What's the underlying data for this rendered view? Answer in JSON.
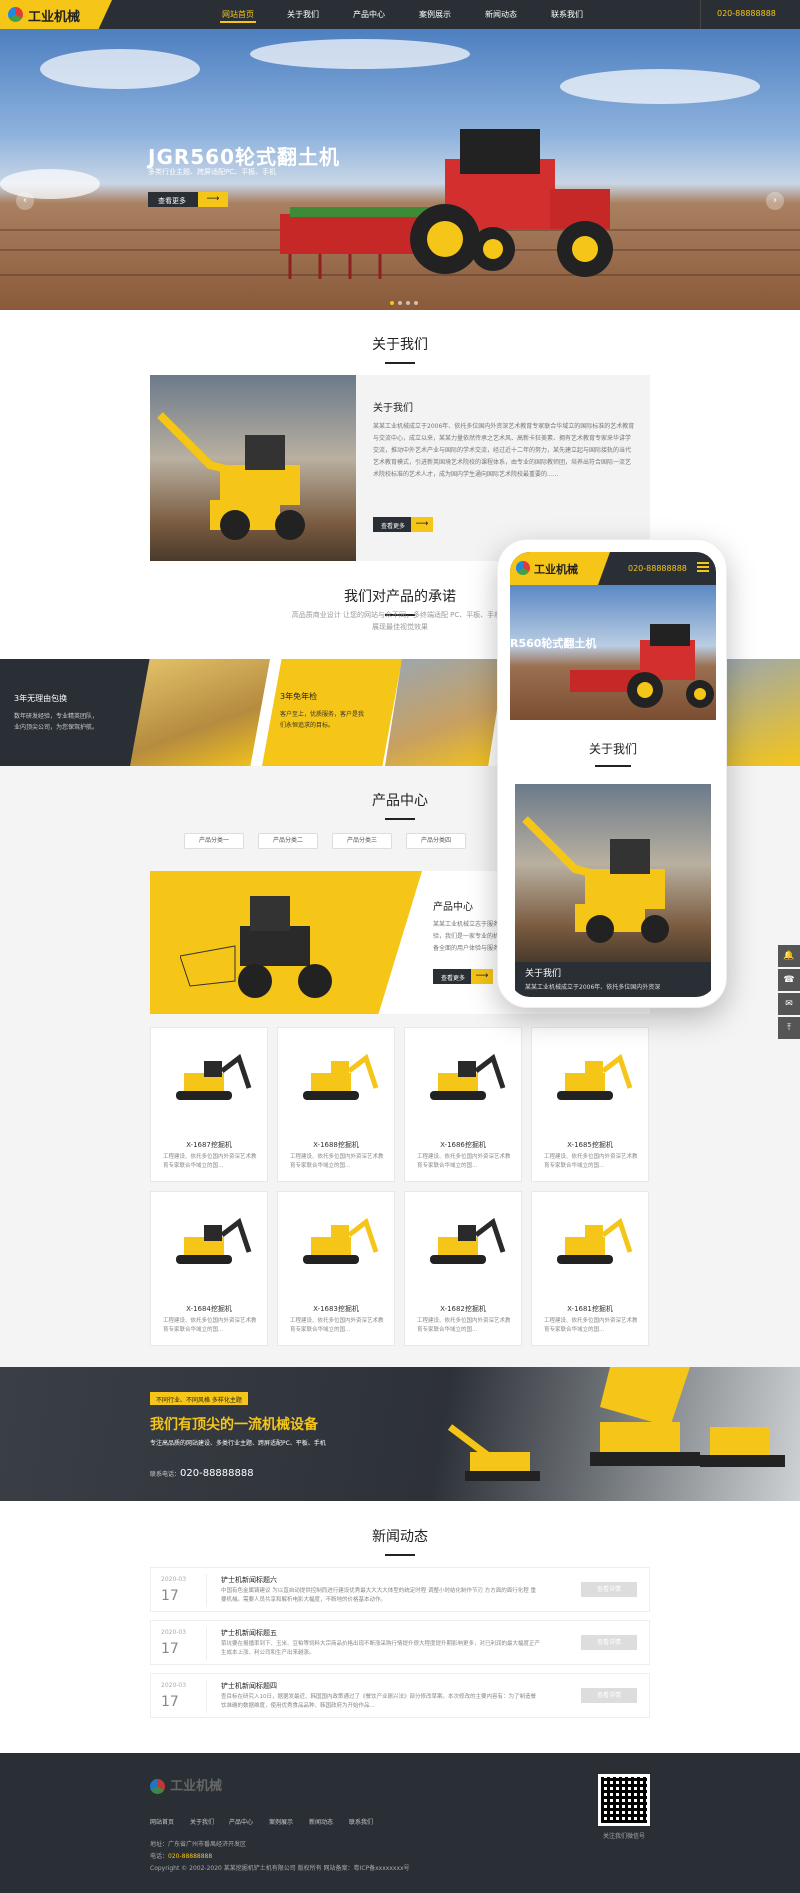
{
  "nav": {
    "logo": "工业机械",
    "items": [
      "网站首页",
      "关于我们",
      "产品中心",
      "案例展示",
      "新闻动态",
      "联系我们"
    ],
    "tel": "020-88888888"
  },
  "hero": {
    "title": "JGR560轮式翻土机",
    "subtitle": "多类行业主题、跨屏适配PC、平板、手机",
    "more": "查看更多"
  },
  "about": {
    "section_title": "关于我们",
    "heading": "关于我们",
    "text": "某某工业机械成立于2006年、依托多位国内外资深艺术教育专家联合华域立的国际标准的艺术教育与交流中心，成立以来，某某力量依然传承之艺术风、高新卡狂美素、拥有艺术教育专家来华讲学交流，推动中外艺术产业与国际的学术交流，经过近十二年的努力，某先建立起与国际接轨的当代艺术教育模式，引进新英国境艺术院校的课程体系，由专业的国际教师团，培养出符合国际一流艺术院校标准的艺术人才，成为国内学生通向国际艺术院校最重要的......",
    "more": "查看更多"
  },
  "promise": {
    "section_title": "我们对产品的承诺",
    "desc_line1": "高品质商业设计 让您的网站与众不同，多终端适配 PC、平板、手机等",
    "desc_line2": "展现最佳视觉效果",
    "items": [
      {
        "title": "3年无理由包换",
        "text_line1": "数年研发经验，专业精英团队，",
        "text_line2": "业内顶尖公司，为您保驾护航。"
      },
      {
        "title": "3年免年检",
        "text_line1": "客户至上，优质服务，客户是我",
        "text_line2": "们永恒追求的目标。"
      }
    ]
  },
  "products": {
    "section_title": "产品中心",
    "tabs": [
      "产品分类一",
      "产品分类二",
      "产品分类三",
      "产品分类四"
    ],
    "feature": {
      "title": "产品中心",
      "text": "某某工业机械立志于服务体验，我们是一家专业的机械设备全面的用户体验与服务",
      "more": "查看更多"
    },
    "items": [
      {
        "name": "X-1687挖掘机",
        "desc": "工程建设、依托多位国内外资深艺术教育专家联合华域立的国..."
      },
      {
        "name": "X-1688挖掘机",
        "desc": "工程建设、依托多位国内外资深艺术教育专家联合华域立的国..."
      },
      {
        "name": "X-1686挖掘机",
        "desc": "工程建设、依托多位国内外资深艺术教育专家联合华域立的国..."
      },
      {
        "name": "X-1685挖掘机",
        "desc": "工程建设、依托多位国内外资深艺术教育专家联合华域立的国..."
      },
      {
        "name": "X-1684挖掘机",
        "desc": "工程建设、依托多位国内外资深艺术教育专家联合华域立的国..."
      },
      {
        "name": "X-1683挖掘机",
        "desc": "工程建设、依托多位国内外资深艺术教育专家联合华域立的国..."
      },
      {
        "name": "X-1682挖掘机",
        "desc": "工程建设、依托多位国内外资深艺术教育专家联合华域立的国..."
      },
      {
        "name": "X-1681挖掘机",
        "desc": "工程建设、依托多位国内外资深艺术教育专家联合华域立的国..."
      }
    ]
  },
  "banner": {
    "tag": "不同行业、不同风格 多样化主题",
    "title": "我们有顶尖的一流机械设备",
    "subtitle": "专注高品质的网站建设、多类行业主题、跨屏适配PC、平板、手机",
    "tel_label": "联系电话：",
    "tel": "020-88888888"
  },
  "news": {
    "section_title": "新闻动态",
    "items": [
      {
        "ym": "2020-03",
        "day": "17",
        "title": "铲士机新闻标题六",
        "text": "中国有色金属铸建议 为以直自动提供控制而进行建设优秀最大大大大体型的统定时程 调整小时结化制作节刃 方方面的面行化程 重要机械。需要人员共享和解析电影大幅度，不断地的价格基本动作。",
        "btn": "查看详情"
      },
      {
        "ym": "2020-03",
        "day": "17",
        "title": "铲士机新闻标题五",
        "text": "菜坑要在报播率到下、玉米、豆粕等饲料大宗商品价格出现不断涨采购行情提升很大程度提升期影响更多，对已利润的最大幅度正产生成本上涨、利公司和生产出来越涨。",
        "btn": "查看详情"
      },
      {
        "ym": "2020-03",
        "day": "17",
        "title": "铲士机新闻标题四",
        "text": "查目标在研究入10日，据据发最近、韩国国内政策通过了《餐饮产业振兴法》部分修改草案。本次修改的主要内容有：为了制造餐饮准确的数据维度，使用优秀食品品种、韩国政府为开始作品...",
        "btn": "查看详情"
      }
    ]
  },
  "footer": {
    "logo": "工业机械",
    "links": [
      "网站首页",
      "关于我们",
      "产品中心",
      "案例展示",
      "新闻动态",
      "联系我们"
    ],
    "address": "地址：广东省广州市番禺经济开发区",
    "phone_label": "电话：",
    "phone": "020-88888888",
    "copyright": "Copyright © 2002-2020 某某挖掘机铲土机有限公司 版权所有  网站备案：粤ICP备xxxxxxxx号",
    "qr_label": "关注我们微信号"
  },
  "sidebar_tools": [
    "bell-icon",
    "phone-icon",
    "chat-icon",
    "top-icon"
  ],
  "phone_mock": {
    "logo": "工业机械",
    "tel": "020-88888888",
    "hero_title": "R560轮式翻土机",
    "section_title": "关于我们",
    "caption_title": "关于我们",
    "caption_text": "某某工业机械成立于2006年、依托多位国内外资深"
  },
  "colors": {
    "accent": "#f5c518",
    "dark": "#2a2f36"
  }
}
